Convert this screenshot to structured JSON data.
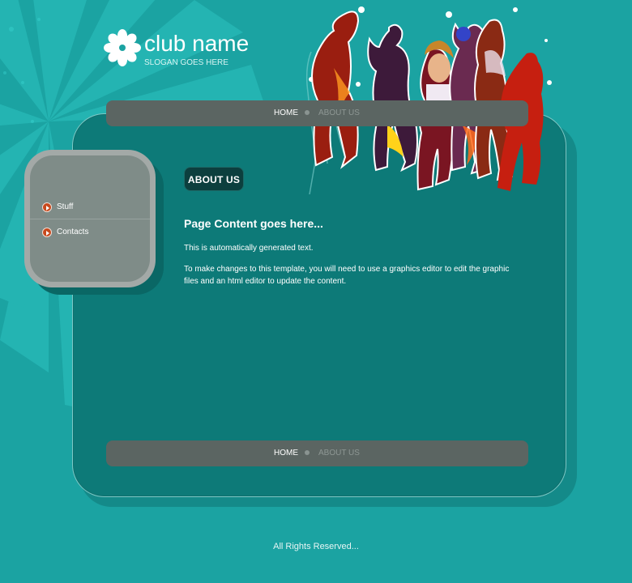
{
  "colors": {
    "background": "#1ba3a2",
    "panel": "#0d7a78",
    "nav_bar": "#5b6562",
    "badge": "#0c3f3e",
    "bullet": "#c8491d"
  },
  "header": {
    "logo_icon": "flower-icon",
    "club_name": "club name",
    "slogan": "SLOGAN GOES HERE"
  },
  "nav_top": {
    "home": "HOME",
    "about": "ABOUT US"
  },
  "nav_bottom": {
    "home": "HOME",
    "about": "ABOUT US"
  },
  "sidebar": {
    "items": [
      {
        "label": "Stuff",
        "icon": "arrow-bullet-icon"
      },
      {
        "label": "Contacts",
        "icon": "arrow-bullet-icon"
      }
    ]
  },
  "content": {
    "badge": "ABOUT US",
    "title": "Page Content goes here...",
    "paragraph1": "This is automatically generated text.",
    "paragraph2": "To make changes to this template, you will need to use a graphics editor to edit the graphic files and an html editor to update the content."
  },
  "footer": {
    "text": "All Rights Reserved..."
  }
}
